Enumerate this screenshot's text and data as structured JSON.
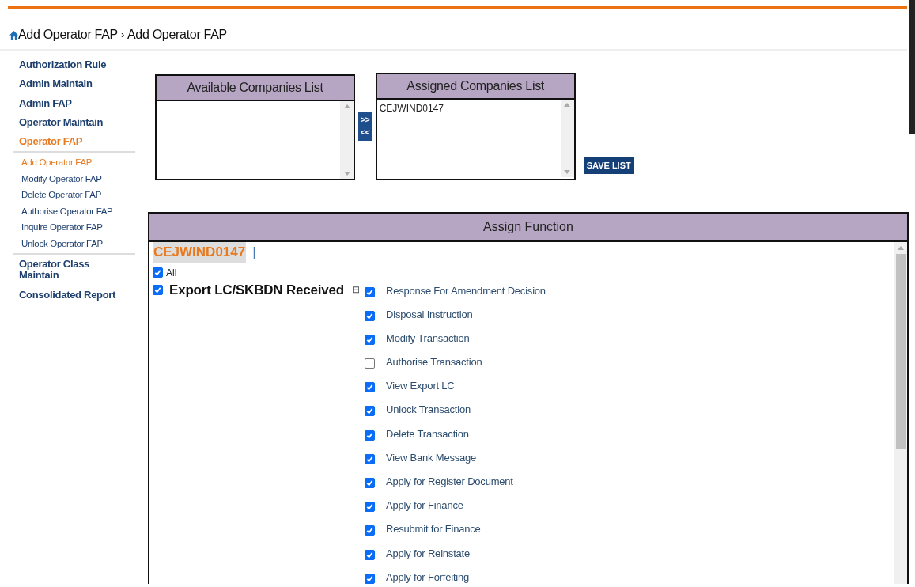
{
  "breadcrumb": {
    "items": [
      "Add Operator FAP",
      "Add Operator FAP"
    ],
    "separator": "›"
  },
  "sidebar": {
    "items": [
      {
        "label": "Authorization Rule",
        "selected": false
      },
      {
        "label": "Admin Maintain",
        "selected": false
      },
      {
        "label": "Admin FAP",
        "selected": false
      },
      {
        "label": "Operator Maintain",
        "selected": false
      },
      {
        "label": "Operator FAP",
        "selected": true,
        "children": [
          {
            "label": "Add Operator FAP",
            "selected": true
          },
          {
            "label": "Modify Operator FAP",
            "selected": false
          },
          {
            "label": "Delete Operator FAP",
            "selected": false
          },
          {
            "label": "Authorise Operator FAP",
            "selected": false
          },
          {
            "label": "Inquire Operator FAP",
            "selected": false
          },
          {
            "label": "Unlock Operator FAP",
            "selected": false
          }
        ]
      },
      {
        "label": "Operator Class Maintain",
        "selected": false
      },
      {
        "label": "Consolidated Report",
        "selected": false
      }
    ]
  },
  "available_list": {
    "title": "Available Companies List"
  },
  "move_buttons": [
    ">>",
    "<<"
  ],
  "assigned_list": {
    "title": "Assigned Companies List",
    "items": [
      "CEJWIND0147"
    ]
  },
  "save_button": "SAVE LIST",
  "assign_function": {
    "title": "Assign Function",
    "company": "CEJWIND0147",
    "divider": "|",
    "all": {
      "label": "All",
      "checked": true
    },
    "group": {
      "label": "Export LC/SKBDN Received",
      "checked": true,
      "toggle": "⊟",
      "expanded": true
    },
    "functions": [
      {
        "label": "Response For Amendment Decision",
        "checked": true
      },
      {
        "label": "Disposal Instruction",
        "checked": true
      },
      {
        "label": "Modify Transaction",
        "checked": true
      },
      {
        "label": "Authorise Transaction",
        "checked": false
      },
      {
        "label": "View Export LC",
        "checked": true
      },
      {
        "label": "Unlock Transaction",
        "checked": true
      },
      {
        "label": "Delete Transaction",
        "checked": true
      },
      {
        "label": "View Bank Message",
        "checked": true
      },
      {
        "label": "Apply for Register Document",
        "checked": true
      },
      {
        "label": "Apply for Finance",
        "checked": true
      },
      {
        "label": "Resubmit for Finance",
        "checked": true
      },
      {
        "label": "Apply for Reinstate",
        "checked": true
      },
      {
        "label": "Apply for Forfeiting",
        "checked": true
      }
    ]
  }
}
